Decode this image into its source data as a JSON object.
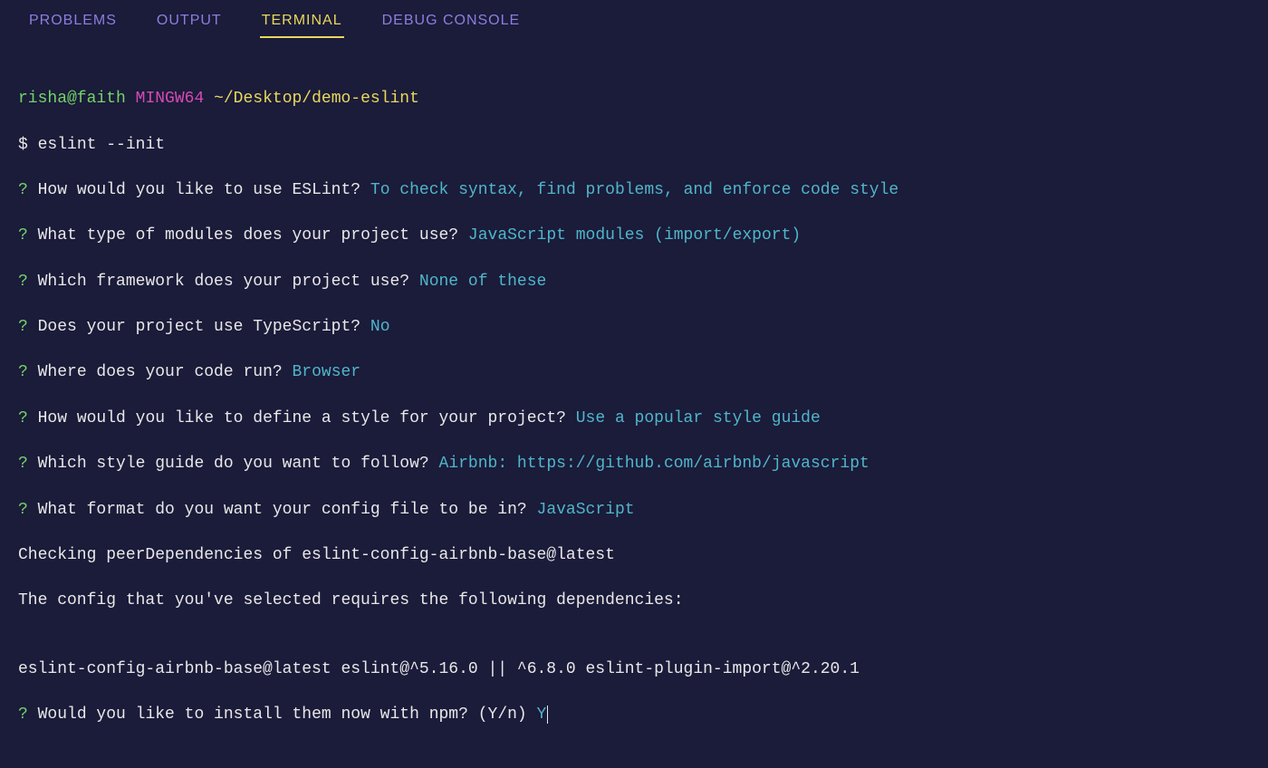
{
  "tabs": {
    "problems": "PROBLEMS",
    "output": "OUTPUT",
    "terminal": "TERMINAL",
    "debug_console": "DEBUG CONSOLE"
  },
  "prompt": {
    "user": "risha@faith",
    "env": "MINGW64",
    "path": "~/Desktop/demo-eslint",
    "cmd_prefix": "$ ",
    "command": "eslint --init"
  },
  "qa": [
    {
      "q": "How would you like to use ESLint?",
      "a": "To check syntax, find problems, and enforce code style"
    },
    {
      "q": "What type of modules does your project use?",
      "a": "JavaScript modules (import/export)"
    },
    {
      "q": "Which framework does your project use?",
      "a": "None of these"
    },
    {
      "q": "Does your project use TypeScript?",
      "a": "No"
    },
    {
      "q": "Where does your code run?",
      "a": "Browser"
    },
    {
      "q": "How would you like to define a style for your project?",
      "a": "Use a popular style guide"
    },
    {
      "q": "Which style guide do you want to follow?",
      "a": "Airbnb: https://github.com/airbnb/javascript"
    },
    {
      "q": "What format do you want your config file to be in?",
      "a": "JavaScript"
    }
  ],
  "info": {
    "checking": "Checking peerDependencies of eslint-config-airbnb-base@latest",
    "requires": "The config that you've selected requires the following dependencies:",
    "blank": "",
    "deps": "eslint-config-airbnb-base@latest eslint@^5.16.0 || ^6.8.0 eslint-plugin-import@^2.20.1"
  },
  "final": {
    "q": "Would you like to install them now with npm?",
    "hint": "(Y/n) ",
    "input": "Y"
  },
  "glyphs": {
    "qmark": "?"
  }
}
